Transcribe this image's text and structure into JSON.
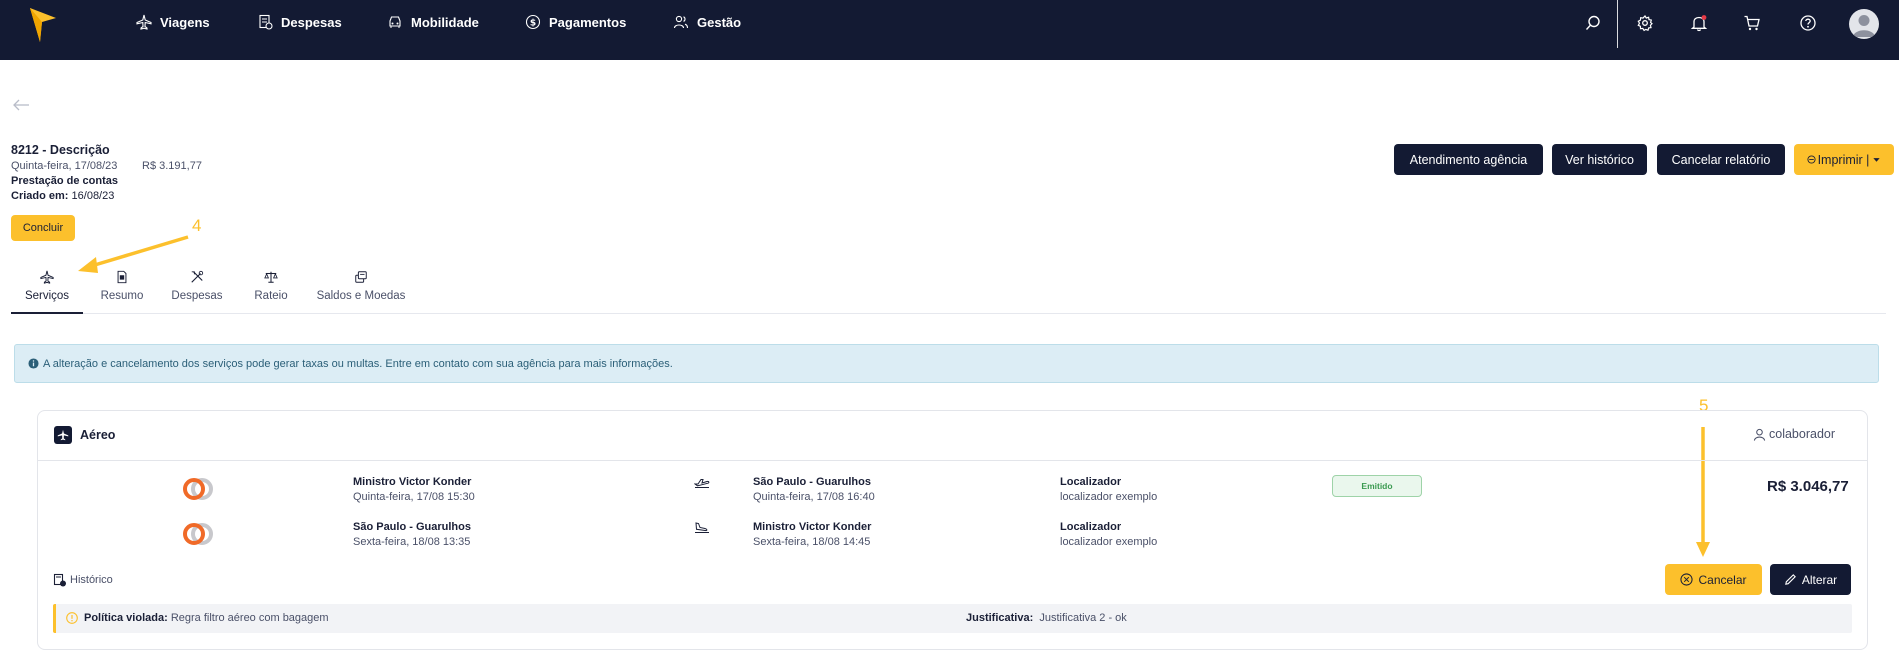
{
  "nav": {
    "items": [
      {
        "label": "Viagens",
        "icon": "plane-icon"
      },
      {
        "label": "Despesas",
        "icon": "receipt-icon"
      },
      {
        "label": "Mobilidade",
        "icon": "car-icon"
      },
      {
        "label": "Pagamentos",
        "icon": "dollar-icon"
      },
      {
        "label": "Gestão",
        "icon": "users-icon"
      }
    ]
  },
  "report": {
    "title": "8212 - Descrição",
    "date": "Quinta-feira, 17/08/23",
    "amount": "R$ 3.191,77",
    "type": "Prestação de contas",
    "created_label": "Criado em:",
    "created_value": "16/08/23",
    "conclude_label": "Concluir"
  },
  "actions": {
    "agency": "Atendimento agência",
    "history": "Ver histórico",
    "cancel_report": "Cancelar relatório",
    "print": "Imprimir |"
  },
  "tabs": [
    {
      "label": "Serviços",
      "icon": "plane-icon",
      "active": true
    },
    {
      "label": "Resumo",
      "icon": "document-icon",
      "active": false
    },
    {
      "label": "Despesas",
      "icon": "tools-icon",
      "active": false
    },
    {
      "label": "Rateio",
      "icon": "scale-icon",
      "active": false
    },
    {
      "label": "Saldos e Moedas",
      "icon": "coins-icon",
      "active": false
    }
  ],
  "alert": {
    "text": "A alteração e cancelamento dos serviços pode gerar taxas ou multas. Entre em contato com sua agência para mais informações."
  },
  "card": {
    "title": "Aéreo",
    "collaborator": "colaborador",
    "status_badge": "Emitido",
    "price": "R$ 3.046,77",
    "history_label": "Histórico",
    "cancel_label": "Cancelar",
    "edit_label": "Alterar",
    "flights": [
      {
        "origin": "Ministro Victor Konder",
        "departure": "Quinta-feira, 17/08 15:30",
        "destination": "São Paulo - Guarulhos",
        "arrival": "Quinta-feira, 17/08 16:40",
        "locator_label": "Localizador",
        "locator_value": "localizador exemplo"
      },
      {
        "origin": "São Paulo - Guarulhos",
        "departure": "Sexta-feira, 18/08 13:35",
        "destination": "Ministro Victor Konder",
        "arrival": "Sexta-feira, 18/08 14:45",
        "locator_label": "Localizador",
        "locator_value": "localizador exemplo"
      }
    ],
    "policy": {
      "violated_label": "Política violada:",
      "violated_value": "Regra filtro aéreo com bagagem",
      "justification_label": "Justificativa:",
      "justification_value": "Justificativa 2 - ok"
    }
  },
  "annotations": {
    "step_4": "4",
    "step_5": "5"
  },
  "colors": {
    "topbar": "#131a33",
    "accent_yellow": "#fcc02c",
    "dark_button": "#131a33",
    "alert_bg": "#dcedf5"
  }
}
